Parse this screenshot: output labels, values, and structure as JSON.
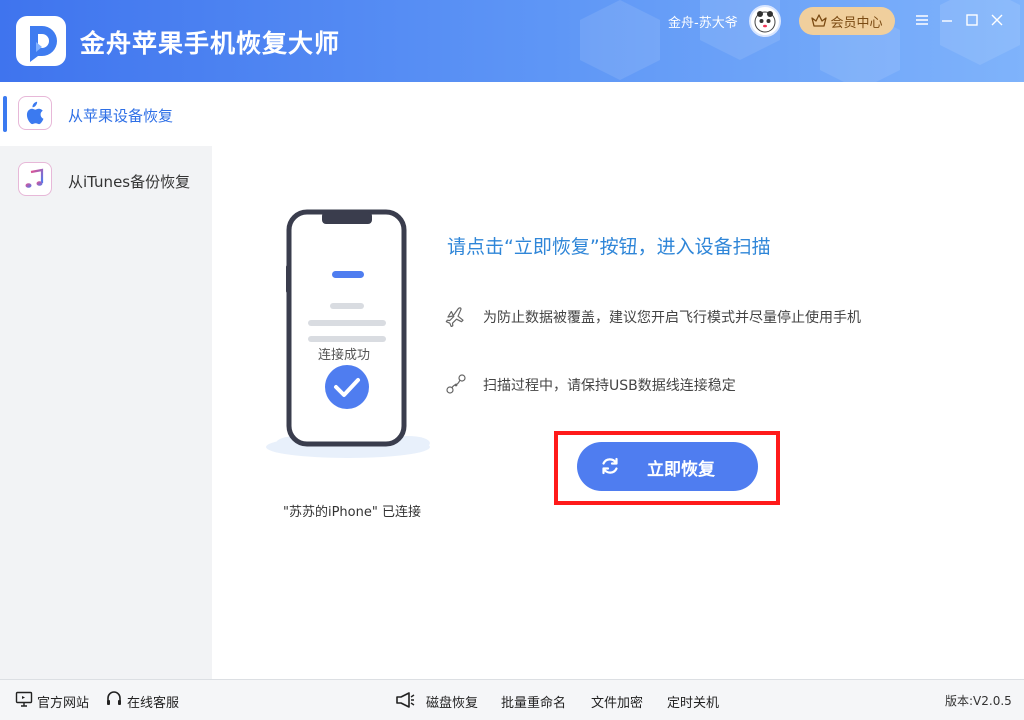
{
  "app": {
    "title": "金舟苹果手机恢复大师"
  },
  "header": {
    "user_name": "金舟-苏大爷",
    "vip_label": "会员中心",
    "window_controls": [
      "menu-icon",
      "minimize-icon",
      "maximize-icon",
      "close-icon"
    ]
  },
  "sidebar": {
    "items": [
      {
        "label": "从苹果设备恢复",
        "icon": "apple-icon",
        "active": true
      },
      {
        "label": "从iTunes备份恢复",
        "icon": "music-note-icon",
        "active": false
      }
    ]
  },
  "main": {
    "phone_status": "连接成功",
    "device_status": "\"苏苏的iPhone\" 已连接",
    "headline": "请点击“立即恢复”按钮，进入设备扫描",
    "tips": [
      {
        "icon": "airplane-icon",
        "text": "为防止数据被覆盖，建议您开启飞行模式并尽量停止使用手机"
      },
      {
        "icon": "usb-cable-icon",
        "text": "扫描过程中，请保持USB数据线连接稳定"
      }
    ],
    "recover_button": "立即恢复"
  },
  "footer": {
    "left_links": [
      "官方网站",
      "在线客服"
    ],
    "center_links": [
      "磁盘恢复",
      "批量重命名",
      "文件加密",
      "定时关机"
    ],
    "version": "版本:V2.0.5"
  },
  "colors": {
    "header_gradient_start": "#3f74ee",
    "header_gradient_end": "#7fb3fb",
    "accent": "#3b7af0",
    "button": "#4f7df0",
    "headline": "#2f86d8",
    "highlight": "#ff1a1a",
    "vip": "#f0cf9d"
  }
}
